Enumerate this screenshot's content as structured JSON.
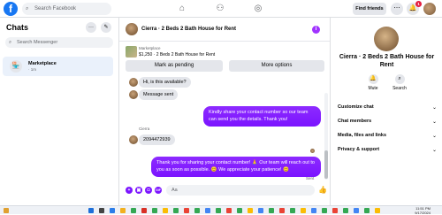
{
  "topbar": {
    "logo": "f",
    "search_placeholder": "Search Facebook",
    "find_friends": "Find friends",
    "messenger_badge": "",
    "notif_badge": "1"
  },
  "sidebar": {
    "title": "Chats",
    "search_placeholder": "Search Messenger",
    "items": [
      {
        "label": "Marketplace",
        "sub": "· 1m"
      }
    ]
  },
  "chat": {
    "title": "Cierra · 2 Beds 2 Bath House for Rent",
    "info_icon": "i",
    "listing": {
      "source": "Marketplace",
      "price_title": "$1,250 · 2 Beds 2 Bath House for Rent",
      "btn_pending": "Mark as pending",
      "btn_more": "More options"
    },
    "messages": [
      {
        "dir": "in",
        "text": "Hi, is this available?"
      },
      {
        "dir": "in",
        "text": "Message sent"
      },
      {
        "dir": "out",
        "text": "Kindly share your contact number so our team can send you the details. Thank you!"
      },
      {
        "dir": "in",
        "sender": "Cierra",
        "text": "2094472939"
      },
      {
        "dir": "out",
        "text": "Thank you for sharing your contact number! 🙏 Our team will reach out to you as soon as possible. 😊 We appreciate your patience! 😊"
      }
    ],
    "sent_label": "Sent",
    "composer_placeholder": "Aa",
    "like_icon": "👍"
  },
  "right_panel": {
    "title": "Cierra · 2 Beds 2 Bath House for Rent",
    "actions": [
      {
        "label": "Mute",
        "icon": "bell-icon"
      },
      {
        "label": "Search",
        "icon": "search-icon"
      }
    ],
    "sections": [
      {
        "label": "Customize chat"
      },
      {
        "label": "Chat members"
      },
      {
        "label": "Media, files and links"
      },
      {
        "label": "Privacy & support"
      }
    ]
  },
  "taskbar": {
    "time": "11:51 PM",
    "date": "9/17/2024"
  },
  "colors": {
    "brand": "#1877f2",
    "accent": "#7b14ff"
  }
}
